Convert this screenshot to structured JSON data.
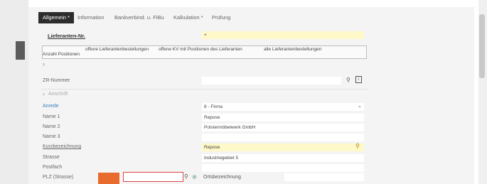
{
  "tabs": [
    {
      "label": "Allgemein *",
      "active": true
    },
    {
      "label": "Information",
      "active": false
    },
    {
      "label": "Bankverbind. u. FiBu",
      "active": false
    },
    {
      "label": "Kalkulation *",
      "active": false
    },
    {
      "label": "Prüfung",
      "active": false
    }
  ],
  "lieferant": {
    "label": "Lieferanten-Nr.",
    "value": "+"
  },
  "table": {
    "headers": [
      "Anzahl Positionen",
      "offene Lieferantenbestellungen",
      "offene KV mit Positionen des Lieferanten",
      "alle Lieferantenbestellungen"
    ]
  },
  "zr": {
    "label": "ZR-Nummer",
    "value": ""
  },
  "section": {
    "label": "Anschrift",
    "expand_icon": "chevron-right"
  },
  "fields": [
    {
      "label": "Anrede",
      "value": "8 - Firma",
      "link": true
    },
    {
      "label": "Name 1",
      "value": "Repose"
    },
    {
      "label": "Name 2",
      "value": "Polstermöbelwerk GmbH"
    },
    {
      "label": "Name 3",
      "value": ""
    },
    {
      "label": "Kurzbezeichnung",
      "value": "Repose",
      "underline": true
    },
    {
      "label": "Strasse",
      "value": "Industriegebiet 5"
    },
    {
      "label": "Postfach",
      "value": ""
    },
    {
      "label": "PLZ (Strasse)",
      "value": ""
    }
  ],
  "ortsbezeichnung": {
    "label": "Ortsbezeichnung"
  },
  "colors": {
    "accent": "#3a7bbd",
    "tab_active": "#2d2d2d",
    "highlight": "#fff8c8",
    "orange": "#e86a2c"
  }
}
